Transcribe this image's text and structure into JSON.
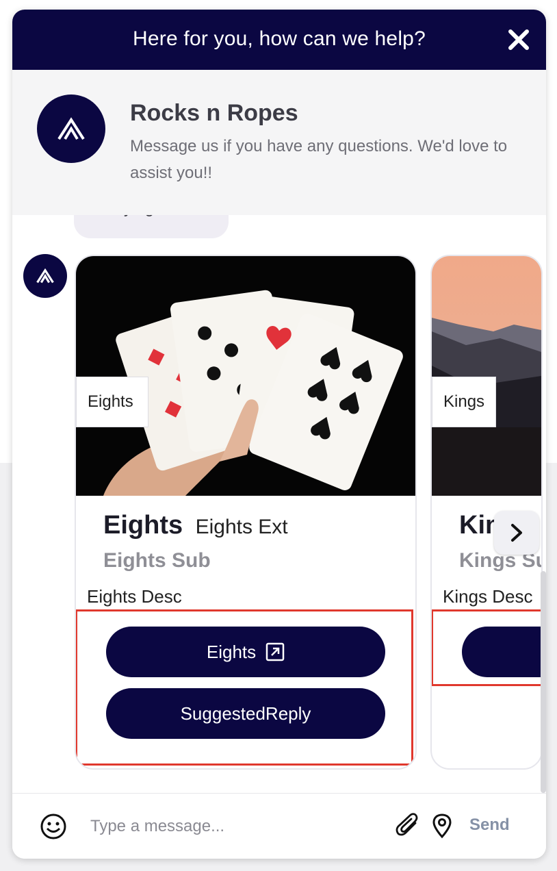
{
  "header": {
    "title": "Here for you, how can we help?"
  },
  "brand": {
    "name": "Rocks n Ropes",
    "tagline": "Message us if you have any questions. We'd love to assist you!!"
  },
  "conversation": {
    "previous_message": "Playing Cards"
  },
  "carousel": {
    "cards": [
      {
        "image_label": "Eights",
        "title": "Eights",
        "title_ext": "Eights Ext",
        "subtitle": "Eights Sub",
        "description": "Eights Desc",
        "buttons": [
          {
            "label": "Eights",
            "icon": "external-link-icon"
          },
          {
            "label": "SuggestedReply"
          }
        ]
      },
      {
        "image_label": "Kings",
        "title": "Kings",
        "subtitle": "Kings Sub",
        "description": "Kings Desc"
      }
    ]
  },
  "composer": {
    "placeholder": "Type a message...",
    "send_label": "Send"
  },
  "colors": {
    "brand_navy": "#0b0742",
    "highlight_red": "#e0382d",
    "send_gray": "#8591a6"
  }
}
